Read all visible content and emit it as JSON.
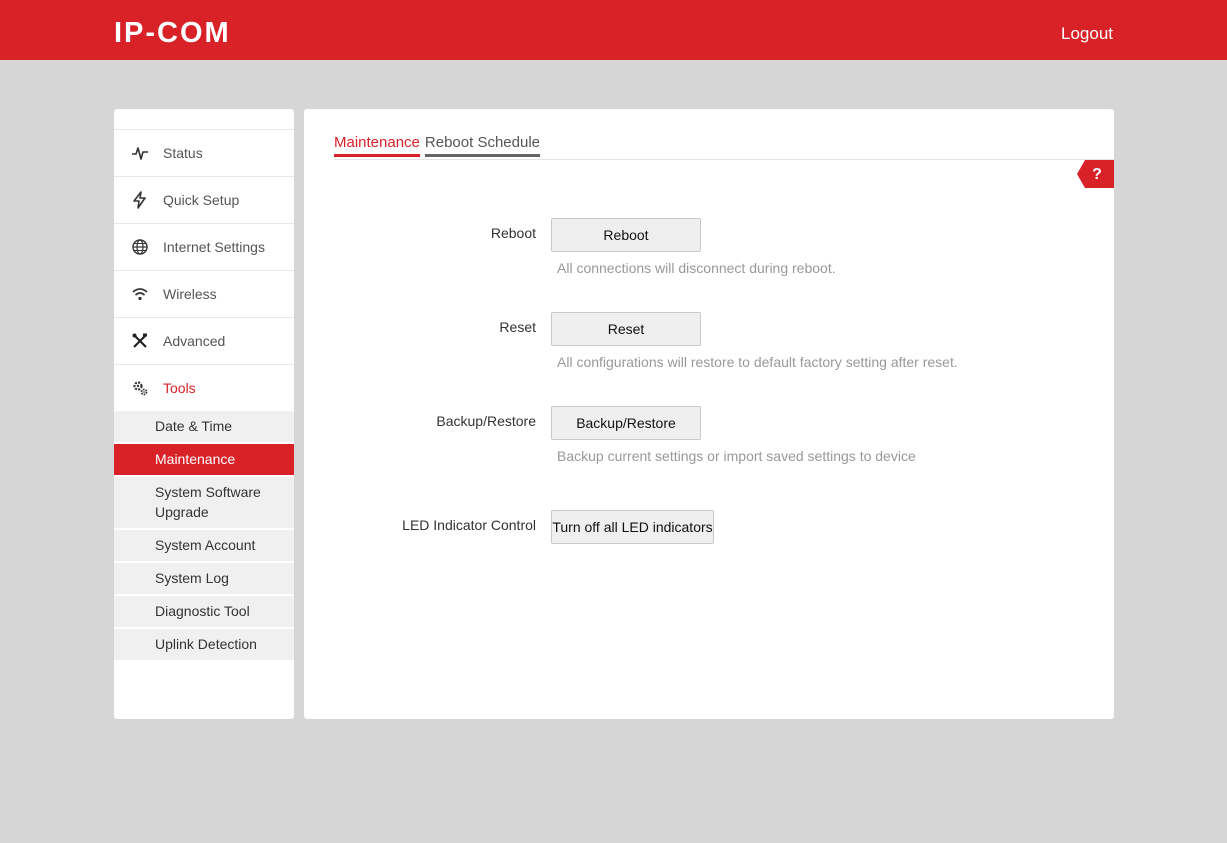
{
  "header": {
    "logo_text": "IP-COM",
    "logout_label": "Logout"
  },
  "sidebar": {
    "items": [
      {
        "label": "Status",
        "icon": "pulse-icon"
      },
      {
        "label": "Quick Setup",
        "icon": "lightning-icon"
      },
      {
        "label": "Internet Settings",
        "icon": "globe-icon"
      },
      {
        "label": "Wireless",
        "icon": "wifi-icon"
      },
      {
        "label": "Advanced",
        "icon": "tools-icon"
      },
      {
        "label": "Tools",
        "icon": "gears-icon"
      }
    ],
    "sub_items": [
      {
        "label": "Date & Time"
      },
      {
        "label": "Maintenance"
      },
      {
        "label": "System Software Upgrade"
      },
      {
        "label": "System Account"
      },
      {
        "label": "System Log"
      },
      {
        "label": "Diagnostic Tool"
      },
      {
        "label": "Uplink Detection"
      }
    ]
  },
  "main": {
    "tabs": [
      {
        "label": "Maintenance"
      },
      {
        "label": "Reboot Schedule"
      }
    ],
    "help_label": "?",
    "rows": {
      "reboot": {
        "label": "Reboot",
        "button": "Reboot",
        "hint": "All connections will disconnect during reboot."
      },
      "reset": {
        "label": "Reset",
        "button": "Reset",
        "hint": "All configurations will restore to default factory setting after reset."
      },
      "backup": {
        "label": "Backup/Restore",
        "button": "Backup/Restore",
        "hint": "Backup current settings or import saved settings to device"
      },
      "led": {
        "label": "LED Indicator Control",
        "button": "Turn off all LED indicators"
      }
    }
  },
  "colors": {
    "brand_red": "#d92128",
    "background": "#d6d6d6"
  }
}
